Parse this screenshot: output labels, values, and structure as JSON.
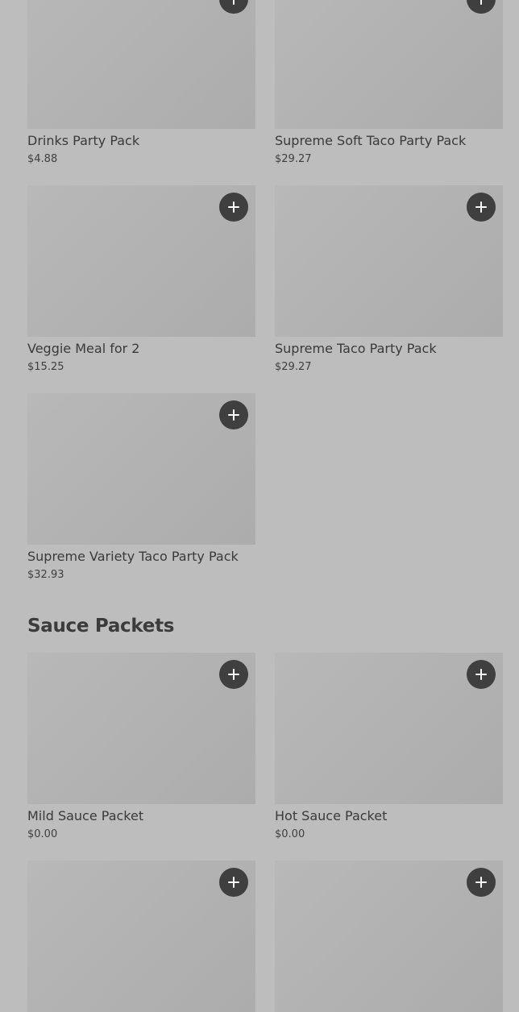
{
  "items": [
    {
      "name": "Drinks Party Pack",
      "price": "$4.88"
    },
    {
      "name": "Supreme Soft Taco Party Pack",
      "price": "$29.27"
    },
    {
      "name": "Veggie Meal for 2",
      "price": "$15.25"
    },
    {
      "name": "Supreme Taco Party Pack",
      "price": "$29.27"
    },
    {
      "name": "Supreme Variety Taco Party Pack",
      "price": "$32.93"
    }
  ],
  "sauce_section": {
    "title": "Sauce Packets",
    "items": [
      {
        "name": "Mild Sauce Packet",
        "price": "$0.00"
      },
      {
        "name": "Hot Sauce Packet",
        "price": "$0.00"
      }
    ]
  },
  "icons": {
    "add": "plus-icon"
  },
  "colors": {
    "background": "#bdbdbd",
    "button": "#3f3f3f",
    "text": "#3a3a3a"
  }
}
